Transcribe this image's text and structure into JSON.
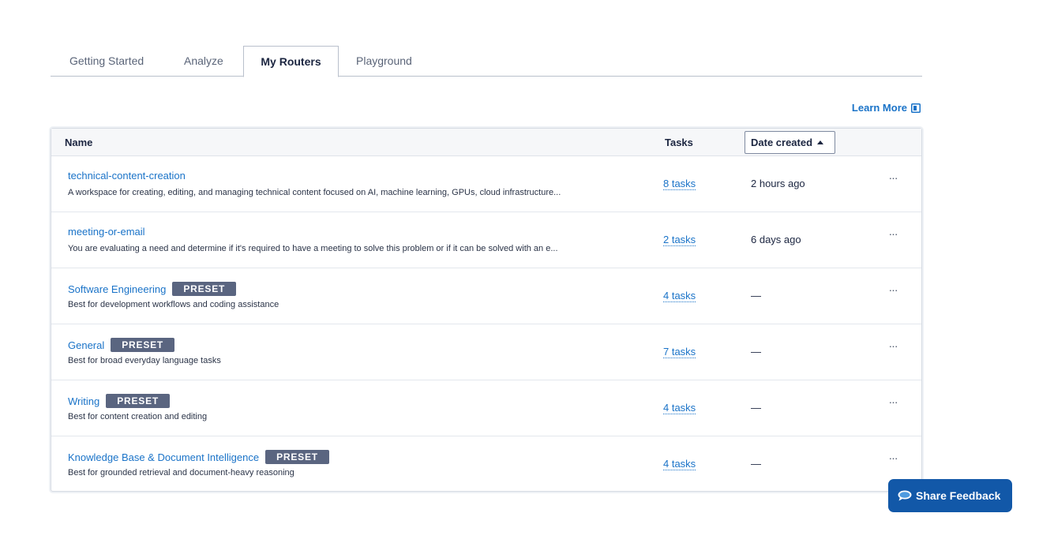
{
  "tabs": [
    {
      "label": "Getting Started"
    },
    {
      "label": "Analyze"
    },
    {
      "label": "My Routers"
    },
    {
      "label": "Playground"
    }
  ],
  "active_tab": "My Routers",
  "learn_more": "Learn More",
  "table": {
    "headers": {
      "name": "Name",
      "tasks": "Tasks",
      "date": "Date created"
    },
    "rows": [
      {
        "name": "technical-content-creation",
        "badge": "",
        "desc": "A workspace for creating, editing, and managing technical content focused on AI, machine learning, GPUs, cloud infrastructure...",
        "tasks": "8 tasks",
        "date": "2 hours ago"
      },
      {
        "name": "meeting-or-email",
        "badge": "",
        "desc": "You are evaluating a need and determine if it's required to have a meeting to solve this problem or if it can be solved with an e...",
        "tasks": "2 tasks",
        "date": "6 days ago"
      },
      {
        "name": "Software Engineering",
        "badge": "PRESET",
        "desc": "Best for development workflows and coding assistance",
        "tasks": "4 tasks",
        "date": "—"
      },
      {
        "name": "General",
        "badge": "PRESET",
        "desc": "Best for broad everyday language tasks",
        "tasks": "7 tasks",
        "date": "—"
      },
      {
        "name": "Writing",
        "badge": "PRESET",
        "desc": "Best for content creation and editing",
        "tasks": "4 tasks",
        "date": "—"
      },
      {
        "name": "Knowledge Base & Document Intelligence",
        "badge": "PRESET",
        "desc": "Best for grounded retrieval and document-heavy reasoning",
        "tasks": "4 tasks",
        "date": "—"
      }
    ],
    "row_action": "···"
  },
  "feedback": {
    "label": "Share Feedback",
    "icon": "chat-bubble-icon"
  },
  "colors": {
    "link": "#1a73c8",
    "badge": "#5a6580",
    "feedback_bg": "#1258a8"
  }
}
